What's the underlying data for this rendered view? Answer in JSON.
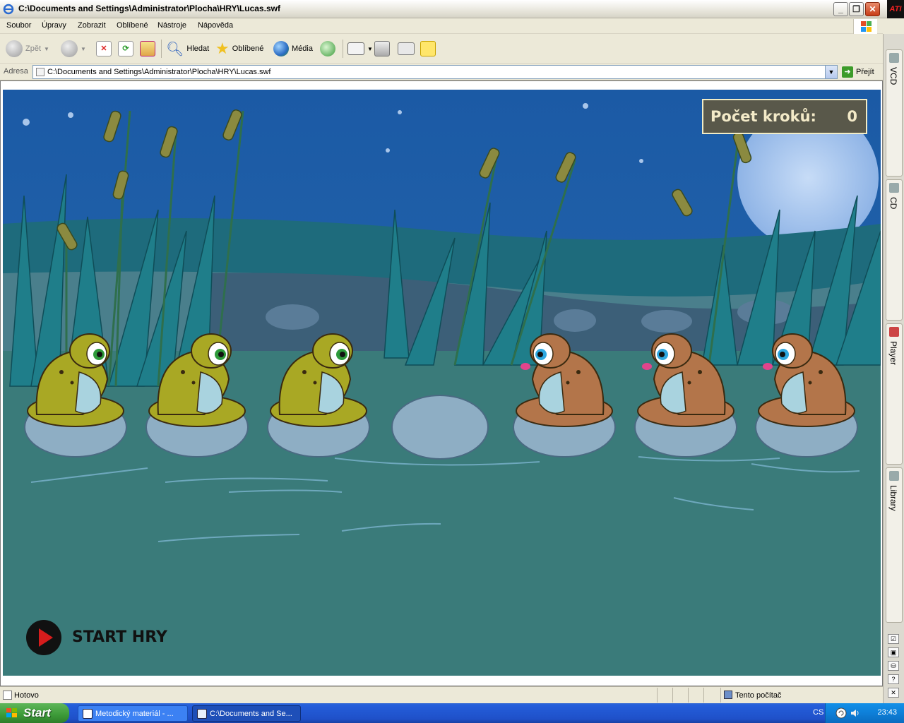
{
  "window": {
    "title": "C:\\Documents and Settings\\Administrator\\Plocha\\HRY\\Lucas.swf"
  },
  "menu": {
    "items": [
      "Soubor",
      "Úpravy",
      "Zobrazit",
      "Oblíbené",
      "Nástroje",
      "Nápověda"
    ]
  },
  "toolbar": {
    "back": "Zpět",
    "search": "Hledat",
    "favorites": "Oblíbené",
    "media": "Média"
  },
  "address": {
    "label": "Adresa",
    "value": "C:\\Documents and Settings\\Administrator\\Plocha\\HRY\\Lucas.swf",
    "go": "Přejít"
  },
  "sidebar": {
    "tabs": [
      "VCD",
      "CD",
      "Player",
      "Library"
    ],
    "buttons": [
      "☑",
      "▣",
      "⛁",
      "?",
      "✕"
    ]
  },
  "game": {
    "counter_label": "Počet kroků:",
    "counter_value": "0",
    "start_label": "START HRY",
    "stones": 7,
    "frogs": [
      "green",
      "green",
      "green",
      "empty",
      "brown",
      "brown",
      "brown"
    ]
  },
  "status": {
    "text": "Hotovo",
    "zone": "Tento počítač"
  },
  "taskbar": {
    "start": "Start",
    "tasks": [
      "Metodický materiál - ...",
      "C:\\Documents and Se..."
    ],
    "lang": "CS",
    "clock": "23:43"
  },
  "colors": {
    "sky": "#1f5fa6",
    "water": "#3a7b7a",
    "frog_green": "#a9a824",
    "frog_brown": "#b3754a",
    "stone": "#8eaec4"
  }
}
